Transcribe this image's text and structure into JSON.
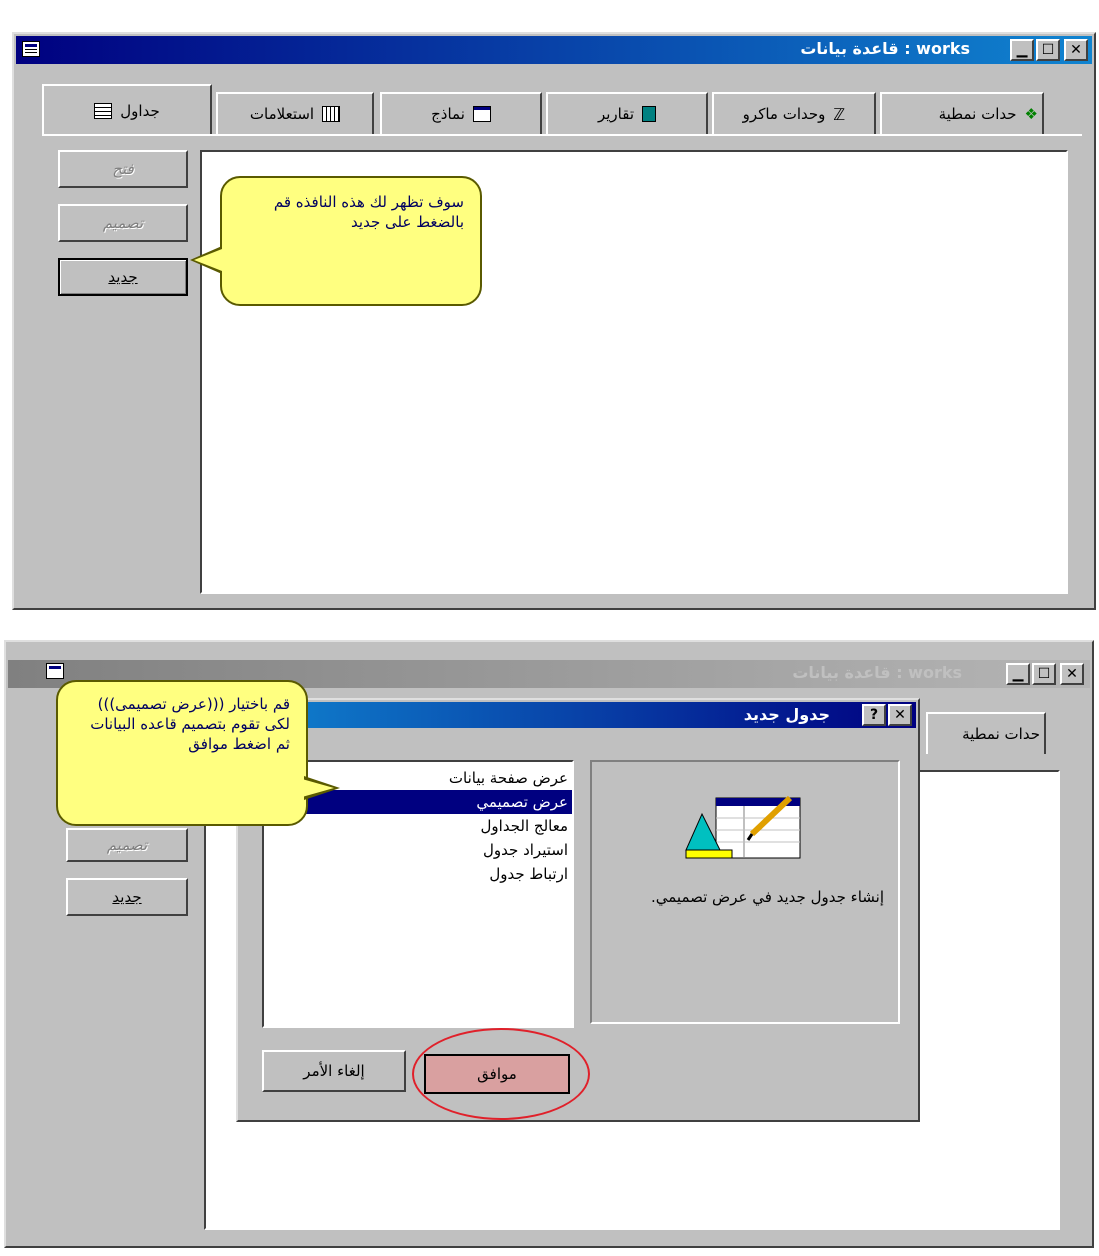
{
  "window_top": {
    "title": "works : قاعدة بيانات",
    "tabs": [
      {
        "label": "جداول",
        "icon": "table-icon"
      },
      {
        "label": "استعلامات",
        "icon": "query-icon"
      },
      {
        "label": "نماذج",
        "icon": "form-icon"
      },
      {
        "label": "تقارير",
        "icon": "report-icon"
      },
      {
        "label": "وحدات ماكرو",
        "icon": "macro-icon"
      },
      {
        "label": "حدات نمطية",
        "icon": "module-icon"
      }
    ],
    "buttons": {
      "open": "فتح",
      "design": "تصميم",
      "new": "جديد"
    },
    "callout": "سوف تظهر لك هذه النافذه قم بالضغط على جديد"
  },
  "window_bottom": {
    "title": "works : قاعدة بيانات",
    "tab_partial": "حدات نمطية",
    "buttons": {
      "design": "تصميم",
      "new": "جديد"
    },
    "callout": "قم باختيار (((عرض تصميمى))) لكى تقوم بتصميم قاعده البيانات ثم اضغط موافق"
  },
  "dialog": {
    "title": "جدول جديد",
    "help_glyph": "?",
    "options": [
      "عرض صفحة بيانات",
      "عرض تصميمي",
      "معالج الجداول",
      "استيراد جدول",
      "ارتباط جدول"
    ],
    "selected_index": 1,
    "description": "إنشاء جدول جديد في عرض تصميمي.",
    "ok_label": "موافق",
    "cancel_label": "إلغاء الأمر"
  },
  "colors": {
    "title_active": "#000080",
    "callout_fill": "#ffff80",
    "highlight_circle": "#e0202a",
    "ok_fill": "#d9a0a0"
  }
}
